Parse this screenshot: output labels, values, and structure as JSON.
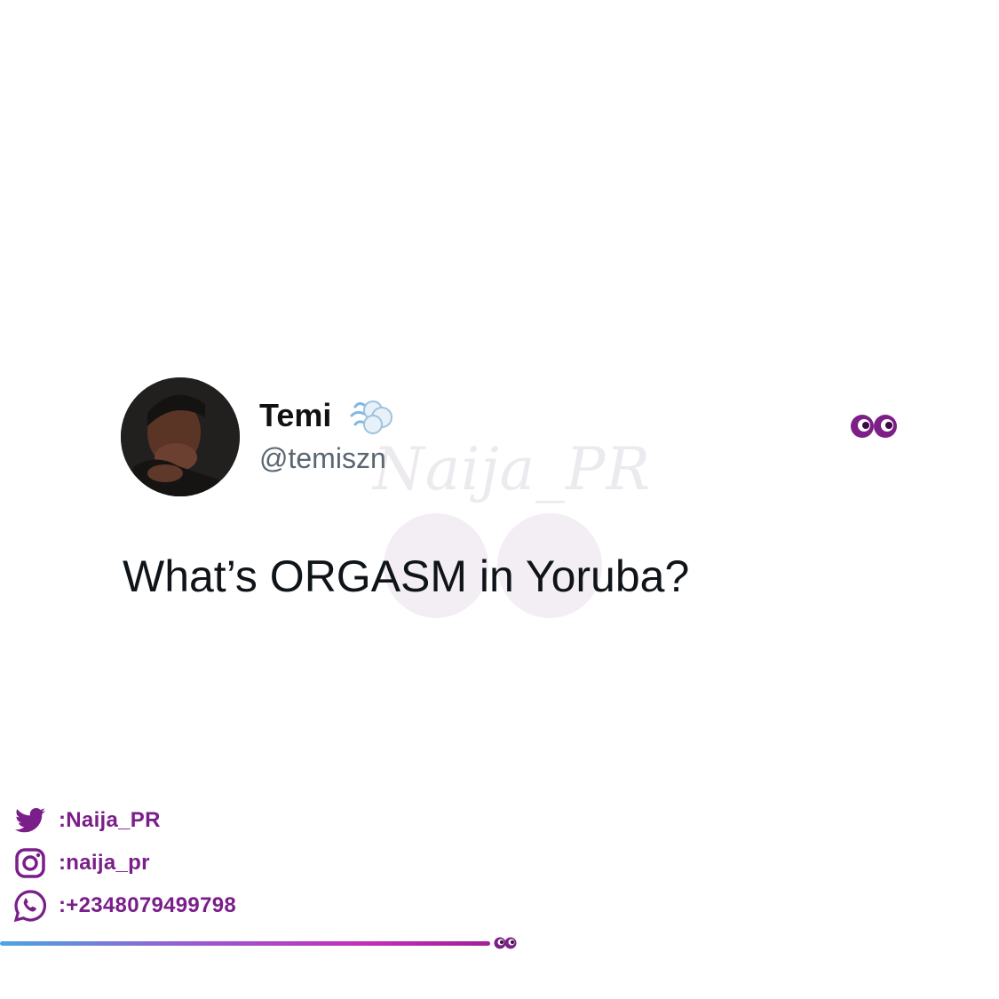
{
  "tweet": {
    "display_name": "Temi",
    "name_emoji": "dashing-away-icon",
    "handle": "@temiszn",
    "text": "What’s ORGASM in Yoruba?",
    "reaction_emoji": "eyes-icon"
  },
  "watermark": {
    "text": "Naija_PR"
  },
  "socials": [
    {
      "icon": "twitter-icon",
      "label": ":Naija_PR"
    },
    {
      "icon": "instagram-icon",
      "label": ":naija_pr"
    },
    {
      "icon": "whatsapp-icon",
      "label": ":+2348079499798"
    }
  ],
  "colors": {
    "brand_purple": "#7a1e8a",
    "eyes_purple": "#7d1f86",
    "text_dark": "#0f1419",
    "handle_gray": "#5b6670"
  }
}
